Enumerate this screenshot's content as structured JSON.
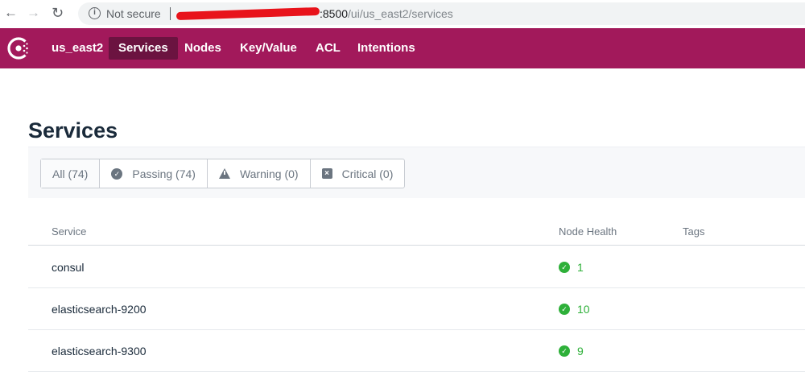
{
  "browser": {
    "security_label": "Not secure",
    "url_port": ":8500",
    "url_path": "/ui/us_east2/services"
  },
  "header": {
    "datacenter": "us_east2",
    "nav": [
      {
        "label": "Services",
        "active": true
      },
      {
        "label": "Nodes"
      },
      {
        "label": "Key/Value"
      },
      {
        "label": "ACL"
      },
      {
        "label": "Intentions"
      }
    ]
  },
  "page": {
    "title": "Services"
  },
  "filters": {
    "all": "All (74)",
    "passing": "Passing (74)",
    "warning": "Warning (0)",
    "critical": "Critical (0)"
  },
  "table": {
    "columns": [
      "Service",
      "Node Health",
      "Tags"
    ],
    "rows": [
      {
        "service": "consul",
        "passing": "1"
      },
      {
        "service": "elasticsearch-9200",
        "passing": "10"
      },
      {
        "service": "elasticsearch-9300",
        "passing": "9"
      }
    ]
  },
  "colors": {
    "brand": "#a2195b",
    "nav_active": "#6b1340",
    "passing": "#2eb039"
  },
  "icons": {
    "logo": "consul-logo-icon",
    "passing": "check-circle-icon",
    "warning": "warning-triangle-icon",
    "critical": "x-square-icon"
  }
}
